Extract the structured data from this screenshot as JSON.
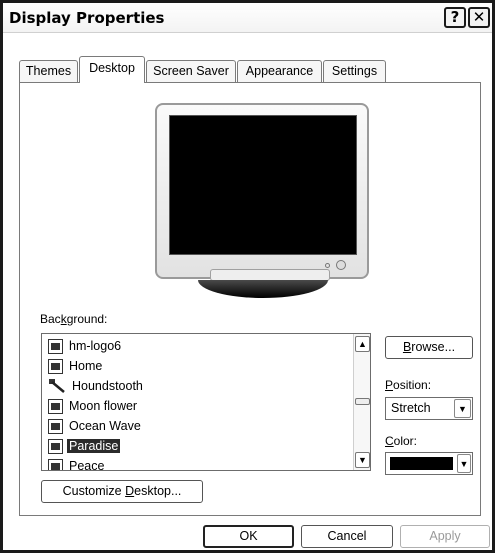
{
  "window": {
    "title": "Display Properties",
    "help_glyph": "?",
    "close_glyph": "✕"
  },
  "tabs": [
    {
      "label": "Themes"
    },
    {
      "label": "Desktop"
    },
    {
      "label": "Screen Saver"
    },
    {
      "label": "Appearance"
    },
    {
      "label": "Settings"
    }
  ],
  "active_tab": "Desktop",
  "background": {
    "label_pre": "Bac",
    "label_key": "k",
    "label_post": "ground:",
    "items": [
      {
        "label": "hm-logo6",
        "icon": "image-file-icon"
      },
      {
        "label": "Home",
        "icon": "image-file-icon"
      },
      {
        "label": "Houndstooth",
        "icon": "pattern-tool-icon"
      },
      {
        "label": "Moon flower",
        "icon": "image-file-icon"
      },
      {
        "label": "Ocean Wave",
        "icon": "image-file-icon"
      },
      {
        "label": "Paradise",
        "icon": "image-file-icon",
        "selected": true
      },
      {
        "label": "Peace",
        "icon": "image-file-icon"
      }
    ],
    "scroll_up_glyph": "▲",
    "scroll_down_glyph": "▼"
  },
  "browse": {
    "label_key": "B",
    "label_post": "rowse..."
  },
  "position": {
    "label_key": "P",
    "label_post": "osition:",
    "value": "Stretch",
    "arrow_glyph": "▼"
  },
  "color": {
    "label_key": "C",
    "label_post": "olor:",
    "value": "#000000",
    "arrow_glyph": "▼"
  },
  "customize": {
    "label_pre": "Customize ",
    "label_key": "D",
    "label_post": "esktop..."
  },
  "buttons": {
    "ok": "OK",
    "cancel": "Cancel",
    "apply": "Apply"
  }
}
